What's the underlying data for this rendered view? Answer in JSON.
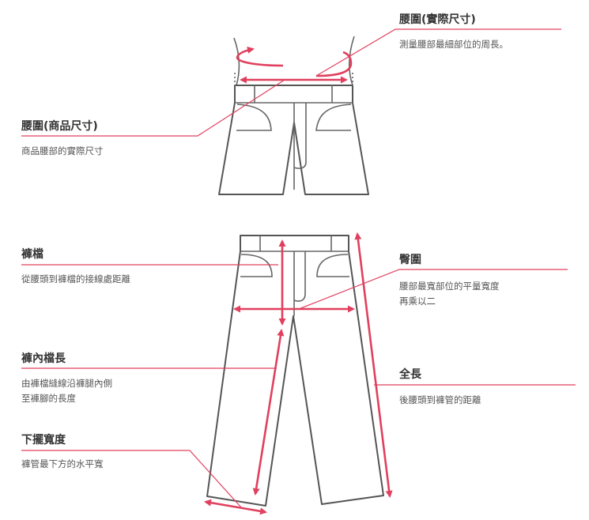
{
  "labels": {
    "waist_actual": {
      "title": "腰圍(實際尺寸)",
      "desc": [
        "測量腰部最細部位的周長。"
      ]
    },
    "waist_product": {
      "title": "腰圍(商品尺寸)",
      "desc": [
        "商品腰部的實際尺寸"
      ]
    },
    "rise": {
      "title": "褲檔",
      "desc": [
        "從腰頭到褲檔的接線處距離"
      ]
    },
    "hip": {
      "title": "臀圍",
      "desc": [
        "腰部最寬部位的平量寬度",
        "再乘以二"
      ]
    },
    "inseam": {
      "title": "褲內檔長",
      "desc": [
        "由褲檔縫線沿褲腿內側",
        "至褲腳的長度"
      ]
    },
    "full_length": {
      "title": "全長",
      "desc": [
        "後腰頭到褲管的距離"
      ]
    },
    "hem_width": {
      "title": "下擺寬度",
      "desc": [
        "褲管最下方的水平寬"
      ]
    }
  },
  "colors": {
    "accent": "#e0405e",
    "outline": "#555555",
    "text": "#333333"
  }
}
